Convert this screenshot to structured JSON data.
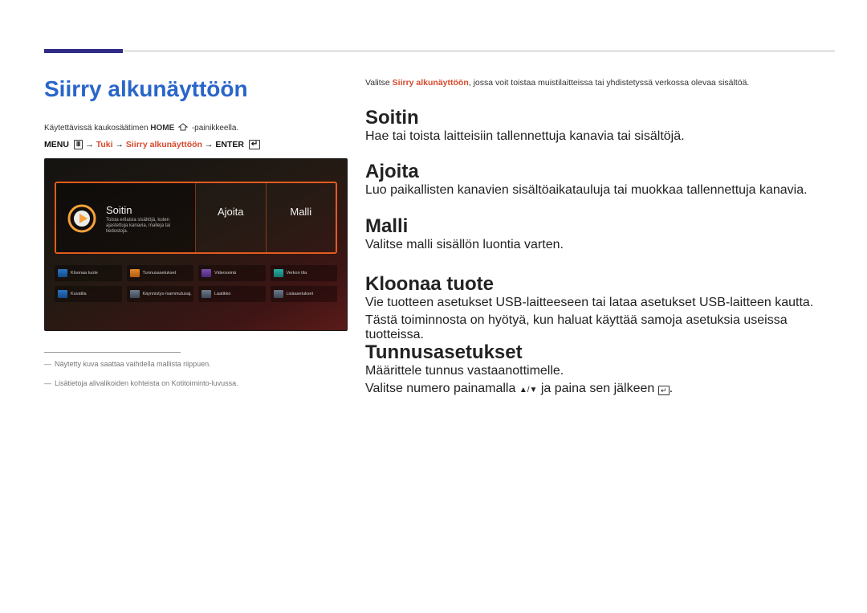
{
  "page_title": "Siirry alkunäyttöön",
  "intro_prefix": "Käytettävissä kaukosäätimen ",
  "intro_bold": "HOME",
  "intro_suffix": " -painikkeella.",
  "menu_path": {
    "menu": "MENU",
    "tuki": "Tuki",
    "siirry": "Siirry alkunäyttöön",
    "enter": "ENTER"
  },
  "screenshot": {
    "tiles": {
      "soitin": "Soitin",
      "ajoita": "Ajoita",
      "malli": "Malli"
    },
    "soitin_sub": "Toista erilaisia sisältöjä, kuten ajastettuja kanavia, malleja tai tiedostoja.",
    "grid": {
      "r1": [
        {
          "label": "Kloonaa tuote",
          "cls": "ic-blue"
        },
        {
          "label": "Tunnusasetukset",
          "cls": "ic-orange"
        },
        {
          "label": "Videoseinä",
          "cls": "ic-purple"
        },
        {
          "label": "Verkon tila",
          "cls": "ic-teal"
        }
      ],
      "r2": [
        {
          "label": "Kuvatila",
          "cls": "ic-blue"
        },
        {
          "label": "Käynnistys-/sammutusaj.",
          "cls": "ic-slate"
        },
        {
          "label": "Laatikko",
          "cls": "ic-slate"
        },
        {
          "label": "Lisäasetukset",
          "cls": "ic-slate"
        }
      ]
    }
  },
  "notes": {
    "n1": "Näytetty kuva saattaa vaihdella mallista riippuen.",
    "n2": "Lisätietoja alivalikoiden kohteista on Kotitoiminto-luvussa."
  },
  "right_intro_prefix": "Valitse ",
  "right_intro_hl": "Siirry alkunäyttöön",
  "right_intro_suffix": ", jossa voit toistaa muistilaitteissa tai yhdistetyssä verkossa olevaa sisältöä.",
  "sections": {
    "soitin": {
      "title": "Soitin",
      "body": "Hae tai toista laitteisiin tallennettuja kanavia tai sisältöjä."
    },
    "ajoita": {
      "title": "Ajoita",
      "body": "Luo paikallisten kanavien sisältöaikatauluja tai muokkaa tallennettuja kanavia."
    },
    "malli": {
      "title": "Malli",
      "body": "Valitse malli sisällön luontia varten."
    },
    "kloonaa": {
      "title": "Kloonaa tuote",
      "body1": "Vie tuotteen asetukset USB-laitteeseen tai lataa asetukset USB-laitteen kautta.",
      "body2": "Tästä toiminnosta on hyötyä, kun haluat käyttää samoja asetuksia useissa tuotteissa."
    },
    "tunnus": {
      "title": "Tunnusasetukset",
      "body1": "Määrittele tunnus vastaanottimelle.",
      "body2a": "Valitse numero painamalla ",
      "body2b": " ja paina sen jälkeen "
    }
  }
}
